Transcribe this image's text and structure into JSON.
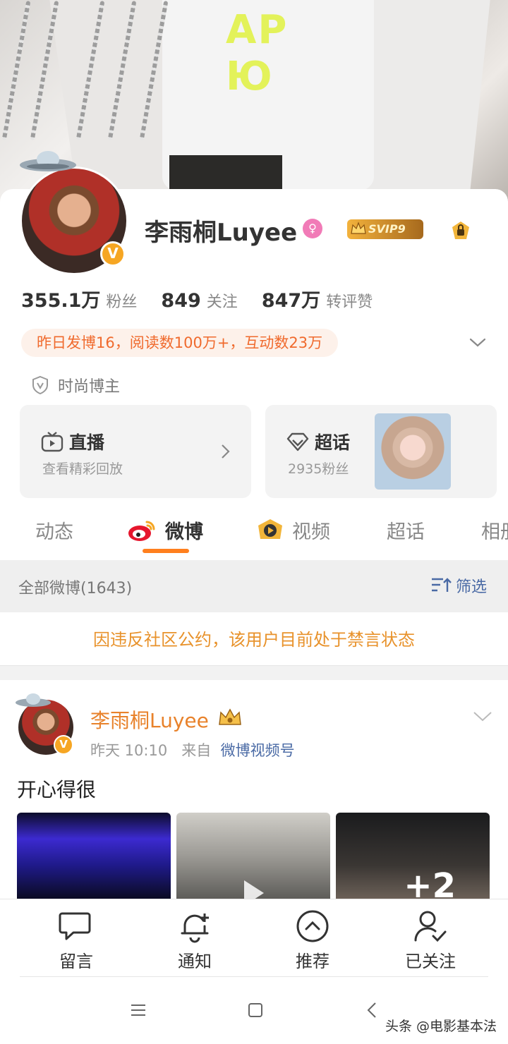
{
  "cover": {
    "print_text": "AP\nЮ"
  },
  "profile": {
    "username": "李雨桐Luyee",
    "gender_icon": "female-icon",
    "svip_label": "SVIP9",
    "verified_mark": "V"
  },
  "stats": [
    {
      "num": "355.1万",
      "label": "粉丝"
    },
    {
      "num": "849",
      "label": "关注"
    },
    {
      "num": "847万",
      "label": "转评赞"
    }
  ],
  "highlight": "昨日发博16，阅读数100万+，互动数23万",
  "tagline": "时尚博主",
  "entries": {
    "live": {
      "title": "直播",
      "sub": "查看精彩回放"
    },
    "topic": {
      "title": "超话",
      "sub": "2935粉丝"
    }
  },
  "tabs": [
    {
      "label": "动态"
    },
    {
      "label": "微博"
    },
    {
      "label": "视频"
    },
    {
      "label": "超话"
    },
    {
      "label": "相册"
    }
  ],
  "filter": {
    "count_label": "全部微博(1643)",
    "filter_label": "筛选"
  },
  "ban_notice": "因违反社区公约，该用户目前处于禁言状态",
  "post": {
    "author": "李雨桐Luyee",
    "time": "昨天 10:10",
    "from_label": "来自",
    "source": "微博视频号",
    "text": "开心得很",
    "more_count": "+2"
  },
  "bottom_bar": [
    {
      "label": "留言",
      "icon": "message-icon"
    },
    {
      "label": "通知",
      "icon": "bell-plus-icon"
    },
    {
      "label": "推荐",
      "icon": "chevron-up-circle-icon"
    },
    {
      "label": "已关注",
      "icon": "user-check-icon"
    }
  ],
  "watermark": "头条 @电影基本法",
  "colors": {
    "accent": "#ff7f1e",
    "name_orange": "#e8822b",
    "link_blue": "#4a6aa5",
    "ban_orange": "#e8922b"
  }
}
